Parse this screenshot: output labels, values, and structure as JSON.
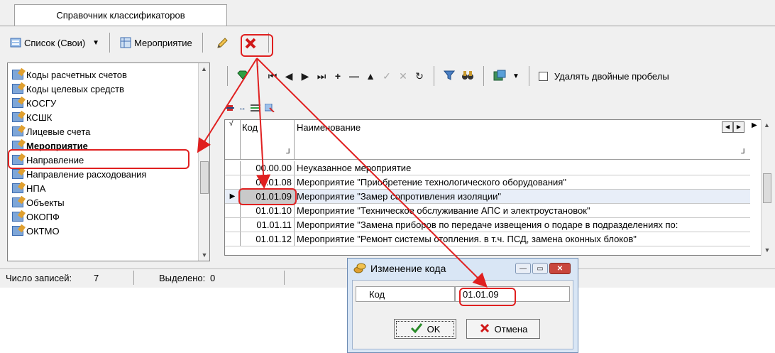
{
  "tab": {
    "label": "Справочник классификаторов"
  },
  "toolbar": {
    "list_label": "Список (Свои)",
    "table_label": "Мероприятие",
    "edit_icon": "pencil-icon",
    "delete_icon": "red-x-icon"
  },
  "tree": {
    "items": [
      "Коды расчетных счетов",
      "Коды целевых средств",
      "КОСГУ",
      "КСШК",
      "Лицевые счета",
      "Мероприятие",
      "Направление",
      "Направление расходования",
      "НПА",
      "Объекты",
      "ОКОПФ",
      "ОКТМО"
    ],
    "selected": "Мероприятие"
  },
  "grid_toolbar": {
    "remove_double_spaces_label": "Удалять двойные пробелы",
    "remove_double_spaces_checked": false
  },
  "grid": {
    "col_code": "Код",
    "col_name": "Наименование",
    "rows": [
      {
        "code": "00.00.00",
        "name": "Неуказанное мероприятие"
      },
      {
        "code": "01.01.08",
        "name": "Мероприятие \"Приобретение технологического оборудования\""
      },
      {
        "code": "01.01.09",
        "name": "Мероприятие \"Замер сопротивления изоляции\""
      },
      {
        "code": "01.01.10",
        "name": "Мероприятие \"Техническое обслуживание АПС и электроустановок\""
      },
      {
        "code": "01.01.11",
        "name": "Мероприятие \"Замена приборов по передаче извещения о подаре в подразделениях по:"
      },
      {
        "code": "01.01.12",
        "name": "Мероприятие \"Ремонт системы отопления. в т.ч. ПСД, замена оконных блоков\""
      }
    ],
    "current_row": 2
  },
  "status": {
    "records_label": "Число записей:",
    "records_value": "7",
    "selected_label": "Выделено:",
    "selected_value": "0"
  },
  "dialog": {
    "title": "Изменение кода",
    "field_label": "Код",
    "field_value": "01.01.09",
    "ok_label": "OK",
    "cancel_label": "Отмена"
  },
  "colors": {
    "highlight": "#e02020",
    "accent": "#3c6bb0"
  }
}
